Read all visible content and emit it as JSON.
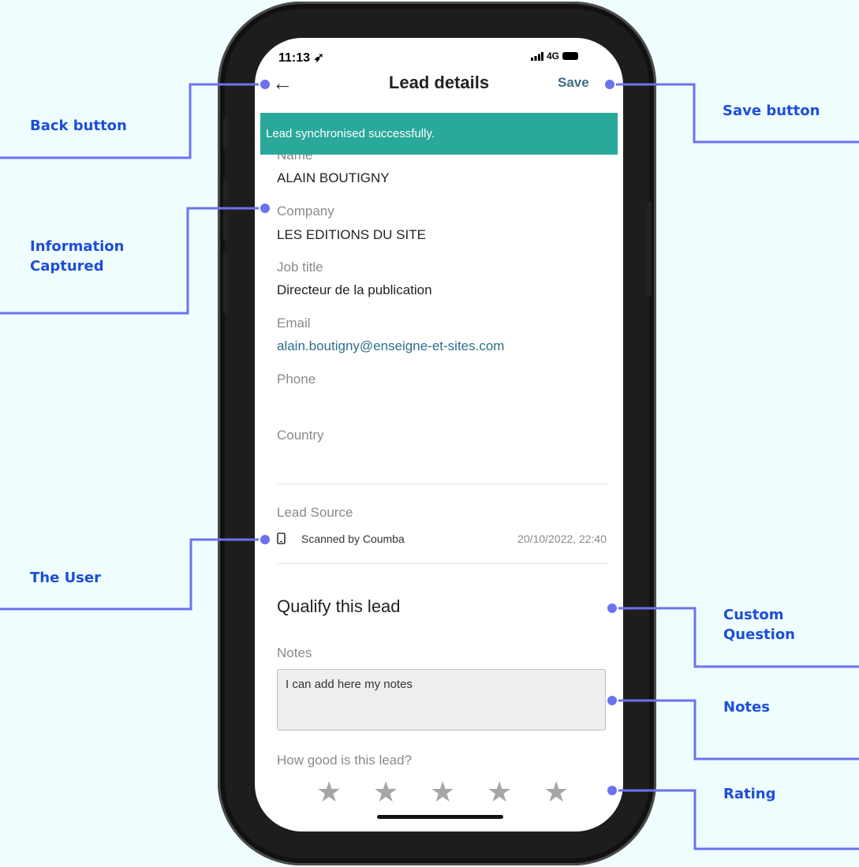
{
  "status": {
    "time": "11:13 ➶",
    "network": "4G"
  },
  "header": {
    "back_icon": "arrow-left-icon",
    "title": "Lead details",
    "save_label": "Save"
  },
  "banner": "Lead synchronised successfully.",
  "fields": [
    {
      "label": "Name",
      "value": "ALAIN BOUTIGNY"
    },
    {
      "label": "Company",
      "value": "LES EDITIONS DU SITE"
    },
    {
      "label": "Job title",
      "value": "Directeur de la publication"
    },
    {
      "label": "Email",
      "value": "alain.boutigny@enseigne-et-sites.com"
    },
    {
      "label": "Phone",
      "value": ""
    },
    {
      "label": "Country",
      "value": ""
    }
  ],
  "lead_source": {
    "label": "Lead Source",
    "icon": "mobile-phone-icon",
    "scanned_by": "Scanned by Coumba",
    "timestamp": "20/10/2022, 22:40"
  },
  "qualify": {
    "heading": "Qualify this lead",
    "notes_label": "Notes",
    "notes_value": "I can add here my notes",
    "rating_label": "How good is this lead?",
    "rating": {
      "value": 0,
      "max": 5,
      "icon": "star-icon"
    }
  },
  "callouts": {
    "back": "Back button",
    "info": "Information\nCaptured",
    "user": "The User",
    "save": "Save button",
    "custom": "Custom\nQuestion",
    "notes": "Notes",
    "rating": "Rating"
  },
  "colors": {
    "page_background": "#effdff",
    "callout": "#1d4ed8",
    "callout_line": "#6b72ef",
    "banner": "#2aa89a",
    "link": "#2d6f8a"
  }
}
